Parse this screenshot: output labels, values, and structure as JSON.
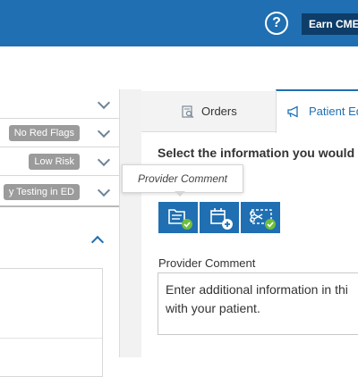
{
  "header": {
    "help_icon": "help-circle-icon",
    "help_glyph": "?",
    "cme_button_label": "Earn CME"
  },
  "left_panel": {
    "rows": [
      {
        "badge": ""
      },
      {
        "badge": "No Red Flags"
      },
      {
        "badge": "Low Risk"
      },
      {
        "badge": "y Testing in ED"
      }
    ]
  },
  "tabs": [
    {
      "label": "Orders",
      "icon": "orders-icon"
    },
    {
      "label": "Patient Ed",
      "icon": "megaphone-icon"
    }
  ],
  "main": {
    "heading": "Select the information you would li",
    "tooltip": "Provider Comment",
    "icon_buttons": [
      {
        "name": "provider-comment-button",
        "icon": "folder-check-icon"
      },
      {
        "name": "calendar-add-button",
        "icon": "calendar-plus-icon"
      },
      {
        "name": "scissors-check-button",
        "icon": "scissors-check-icon"
      }
    ],
    "field_label": "Provider Comment",
    "field_value": "Enter additional information in thi with your patient."
  },
  "colors": {
    "brand": "#1f6fb2",
    "brand_dark": "#0d3d68",
    "badge": "#9b9b9b",
    "check": "#6fbf3b"
  }
}
